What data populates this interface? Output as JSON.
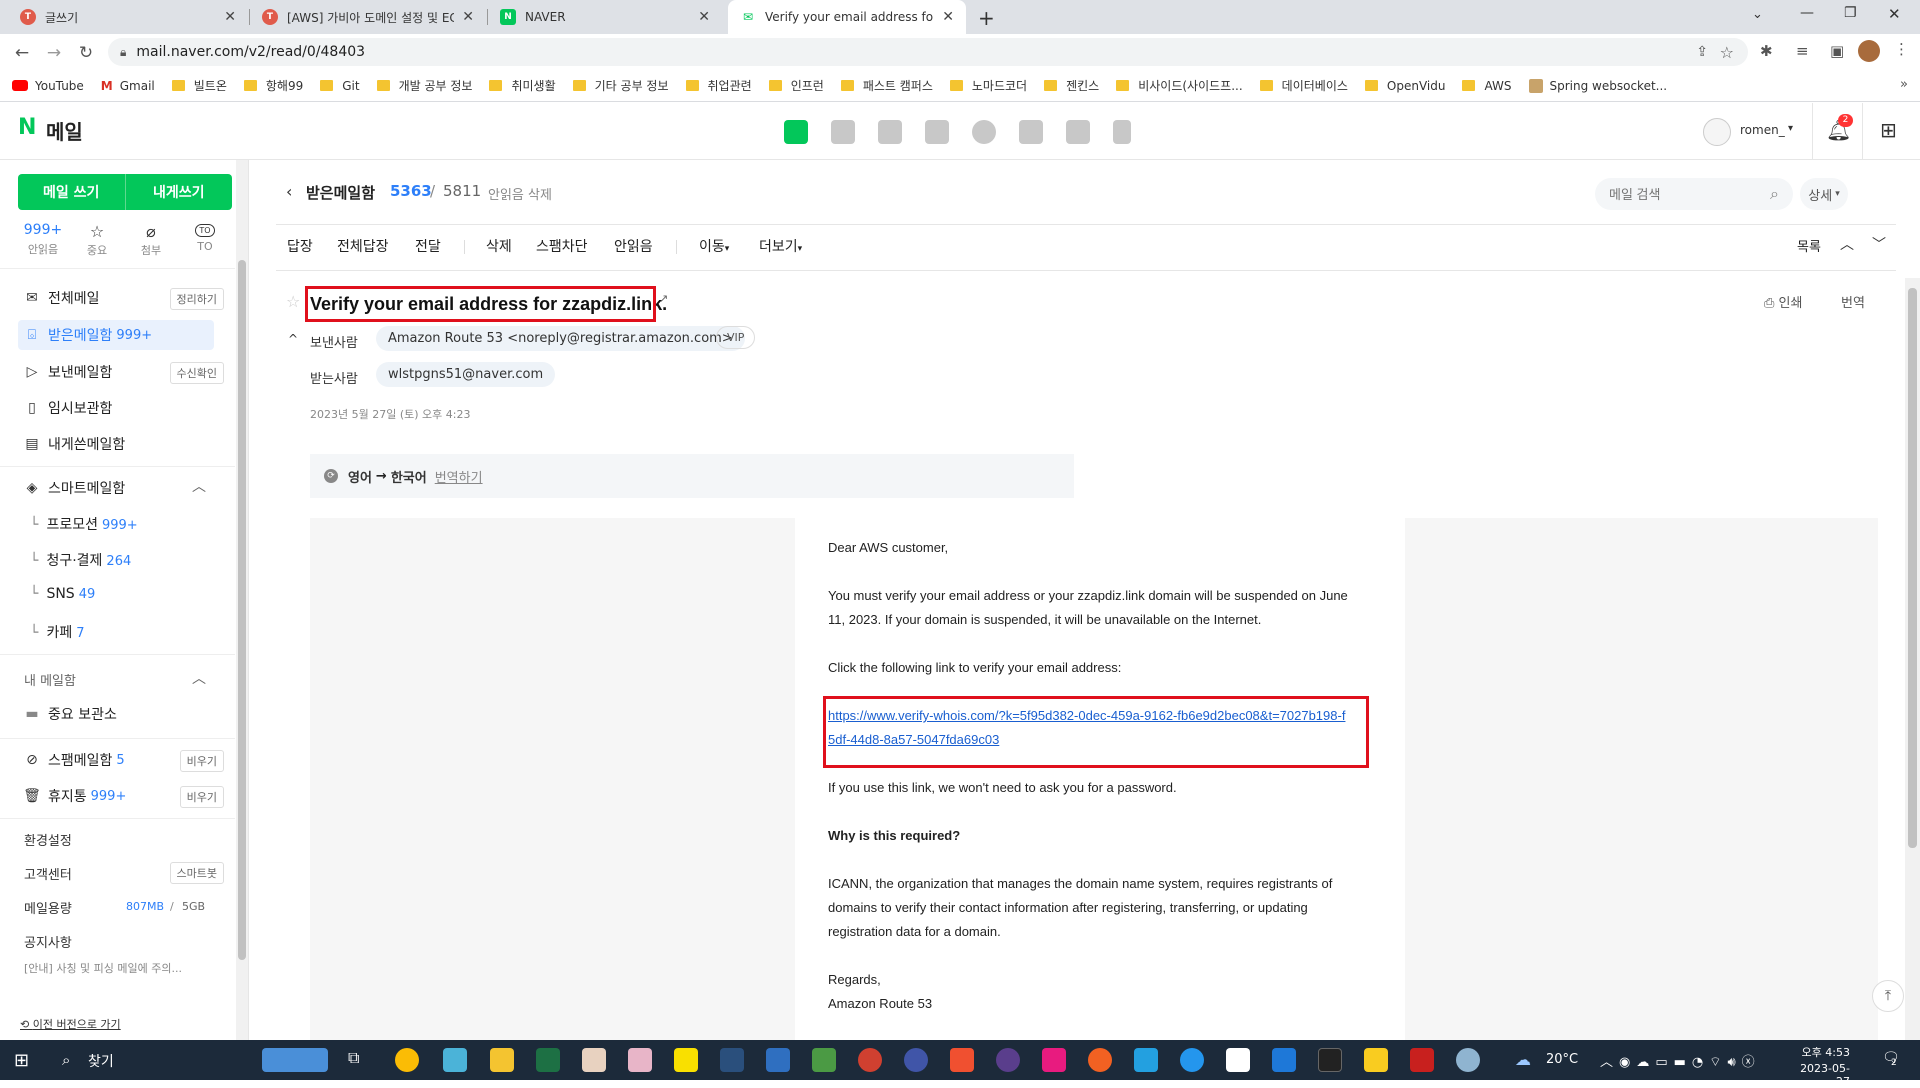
{
  "browser": {
    "tabs": [
      {
        "title": "글쓰기",
        "color": "#e05b4b",
        "icon": "T"
      },
      {
        "title": "[AWS] 가비아 도메인 설정 및 EC",
        "color": "#e05b4b",
        "icon": "T"
      },
      {
        "title": "NAVER",
        "color": "#03c75a",
        "icon": "N"
      },
      {
        "title": "Verify your email address for zz",
        "color": "#03c75a",
        "icon": "✉"
      }
    ],
    "url": "mail.naver.com/v2/read/0/48403",
    "bookmarks": [
      "YouTube",
      "Gmail",
      "빌트온",
      "항해99",
      "Git",
      "개발 공부 정보",
      "취미생활",
      "기타 공부 정보",
      "취업관련",
      "인프런",
      "패스트 캠퍼스",
      "노마드코더",
      "젠킨스",
      "비사이드(사이드프...",
      "데이터베이스",
      "OpenVidu",
      "AWS",
      "Spring websocket..."
    ]
  },
  "header": {
    "logo_n": "N",
    "logo_text": "메일",
    "user": "romen_",
    "notif_count": "2"
  },
  "sidebar": {
    "write_btn": "메일 쓰기",
    "self_btn": "내게쓰기",
    "quick": [
      {
        "top": "999+",
        "label": "안읽음"
      },
      {
        "top": "☆",
        "label": "중요"
      },
      {
        "top": "⌀",
        "label": "첨부"
      },
      {
        "top": "TO",
        "label": "TO"
      }
    ],
    "all_mail": "전체메일",
    "all_mail_btn": "정리하기",
    "inbox": "받은메일함",
    "inbox_count": "999+",
    "sent": "보낸메일함",
    "sent_btn": "수신확인",
    "drafts": "임시보관함",
    "self_mail": "내게쓴메일함",
    "smart": "스마트메일함",
    "smart_items": [
      {
        "label": "프로모션",
        "count": "999+"
      },
      {
        "label": "청구·결제",
        "count": "264"
      },
      {
        "label": "SNS",
        "count": "49"
      },
      {
        "label": "카페",
        "count": "7"
      }
    ],
    "my_mail": "내 메일함",
    "important": "중요 보관소",
    "spam": "스팸메일함",
    "spam_count": "5",
    "empty": "비우기",
    "trash": "휴지통",
    "trash_count": "999+",
    "settings": "환경설정",
    "support": "고객센터",
    "support_btn": "스마트봇",
    "usage_label": "메일용량",
    "usage_used": "807MB",
    "usage_total": "5GB",
    "notice": "공지사항",
    "notice_text": "[안내] 사칭 및 피싱 메일에 주의...",
    "prev_version": "이전 버전으로 가기"
  },
  "main": {
    "folder": "받은메일함",
    "unread": "5363",
    "total": "5811",
    "delete_unread": "안읽음 삭제",
    "search_placeholder": "메일 검색",
    "detail": "상세",
    "toolbar": [
      "답장",
      "전체답장",
      "전달",
      "삭제",
      "스팸차단",
      "안읽음",
      "이동",
      "더보기"
    ],
    "list": "목록",
    "subject": "Verify your email address for zzapdiz.link.",
    "print": "인쇄",
    "translate": "번역",
    "from_label": "보낸사람",
    "from": "Amazon Route 53 <noreply@registrar.amazon.com>",
    "vip": "VIP",
    "to_label": "받는사람",
    "to": "wlstpgns51@naver.com",
    "date": "2023년 5월 27일 (토) 오후 4:23",
    "trans_from": "영어",
    "trans_to": "한국어",
    "trans_action": "번역하기",
    "body": {
      "greeting": "Dear AWS customer,",
      "p1": "You must verify your email address or your zzapdiz.link domain will be suspended on June 11, 2023. If your domain is suspended, it will be unavailable on the Internet.",
      "p2": "Click the following link to verify your email address:",
      "link": "https://www.verify-whois.com/?k=5f95d382-0dec-459a-9162-fb6e9d2bec08&t=7027b198-f5df-44d8-8a57-5047fda69c03",
      "p3": "If you use this link, we won't need to ask you for a password.",
      "h": "Why is this required?",
      "p4": "ICANN, the organization that manages the domain name system, requires registrants of domains to verify their contact information after registering, transferring, or updating registration data for a domain.",
      "regards": "Regards,",
      "sig": "Amazon Route 53"
    }
  },
  "taskbar": {
    "search": "찾기",
    "weather": "20°C",
    "time": "오후 4:53",
    "date": "2023-05-27",
    "notif": "2"
  }
}
